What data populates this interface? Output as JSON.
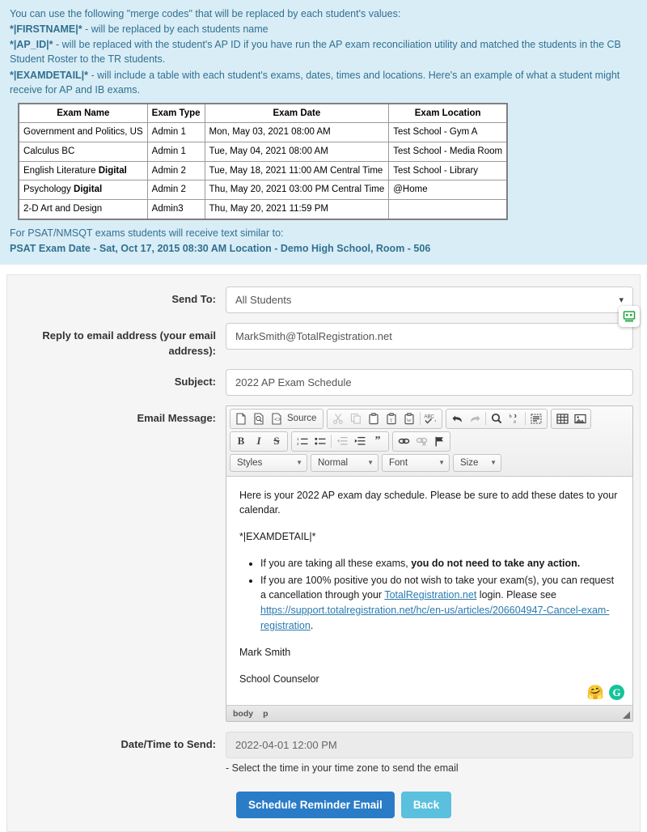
{
  "info": {
    "intro": "You can use the following \"merge codes\" that will be replaced by each student's values:",
    "line_firstname_code": "*|FIRSTNAME|*",
    "line_firstname_text": " - will be replaced by each students name",
    "line_apid_code": "*|AP_ID|*",
    "line_apid_text": " - will be replaced with the student's AP ID if you have run the AP exam reconciliation utility and matched the students in the CB Student Roster to the TR students.",
    "line_examdetail_code": "*|EXAMDETAIL|*",
    "line_examdetail_text": " - will include a table with each student's exams, dates, times and locations. Here's an example of what a student might receive for AP and IB exams.",
    "psat_note": "For PSAT/NMSQT exams students will receive text similar to:",
    "psat_example": "PSAT Exam Date - Sat, Oct 17, 2015 08:30 AM Location - Demo High School, Room - 506"
  },
  "exam_table": {
    "headers": [
      "Exam Name",
      "Exam Type",
      "Exam Date",
      "Exam Location"
    ],
    "rows": [
      {
        "name": "Government and Politics, US",
        "name_bold": "",
        "type": "Admin 1",
        "date": "Mon, May 03, 2021 08:00 AM",
        "location": "Test School - Gym A"
      },
      {
        "name": "Calculus BC",
        "name_bold": "",
        "type": "Admin 1",
        "date": "Tue, May 04, 2021 08:00 AM",
        "location": "Test School - Media Room"
      },
      {
        "name": "English Literature ",
        "name_bold": "Digital",
        "type": "Admin 2",
        "date": "Tue, May 18, 2021 11:00 AM Central Time",
        "location": "Test School - Library"
      },
      {
        "name": "Psychology ",
        "name_bold": "Digital",
        "type": "Admin 2",
        "date": "Thu, May 20, 2021 03:00 PM Central Time",
        "location": "@Home"
      },
      {
        "name": "2-D Art and Design",
        "name_bold": "",
        "type": "Admin3",
        "date": "Thu, May 20, 2021 11:59 PM",
        "location": ""
      }
    ]
  },
  "form": {
    "send_to": {
      "label": "Send To:",
      "value": "All Students"
    },
    "reply_to": {
      "label": "Reply to email address (your email address):",
      "value": "MarkSmith@TotalRegistration.net"
    },
    "subject": {
      "label": "Subject:",
      "value": "2022 AP Exam Schedule"
    },
    "email_message": {
      "label": "Email Message:"
    },
    "datetime": {
      "label": "Date/Time to Send:",
      "value": "2022-04-01 12:00 PM",
      "hint": "- Select the time in your time zone to send the email"
    }
  },
  "editor": {
    "toolbar": {
      "source_label": "Source",
      "row1": [
        "new-page-icon",
        "preview-icon",
        "templates-icon",
        "cut-icon",
        "copy-icon",
        "paste-icon",
        "paste-text-icon",
        "paste-word-icon",
        "spellcheck-icon",
        "undo-icon",
        "redo-icon",
        "find-icon",
        "replace-icon",
        "select-all-icon",
        "table-icon",
        "image-icon"
      ],
      "row2": [
        "bold-icon",
        "italic-icon",
        "strikethrough-icon",
        "numbered-list-icon",
        "bulleted-list-icon",
        "outdent-icon",
        "indent-icon",
        "blockquote-icon",
        "link-icon",
        "unlink-icon",
        "anchor-icon"
      ],
      "combos": [
        {
          "label": "Styles"
        },
        {
          "label": "Normal"
        },
        {
          "label": "Font"
        },
        {
          "label": "Size"
        }
      ]
    },
    "body": {
      "intro": "Here is your 2022 AP exam day schedule. Please be sure to add these dates to your calendar.",
      "merge_code": "*|EXAMDETAIL|*",
      "bullet1_pre": "If you are taking all these exams, ",
      "bullet1_bold": "you do not need to take any action.",
      "bullet2_pre": "If you are 100% positive you do not wish to take your exam(s), you can request a cancellation through your ",
      "bullet2_link": "TotalRegistration.net",
      "bullet2_mid": " login. Please see ",
      "bullet2_url": "https://support.totalregistration.net/hc/en-us/articles/206604947-Cancel-exam-registration",
      "bullet2_post": ".",
      "signature_name": "Mark Smith",
      "signature_title": "School Counselor"
    },
    "status": {
      "path1": "body",
      "path2": "p"
    }
  },
  "buttons": {
    "schedule": "Schedule Reminder Email",
    "back": "Back"
  },
  "colors": {
    "info_bg": "#d9edf7",
    "info_text": "#31708f",
    "primary": "#2a7cc7",
    "info_btn": "#5bc0de",
    "link": "#2a7ab0",
    "grammarly": "#15c39a"
  }
}
